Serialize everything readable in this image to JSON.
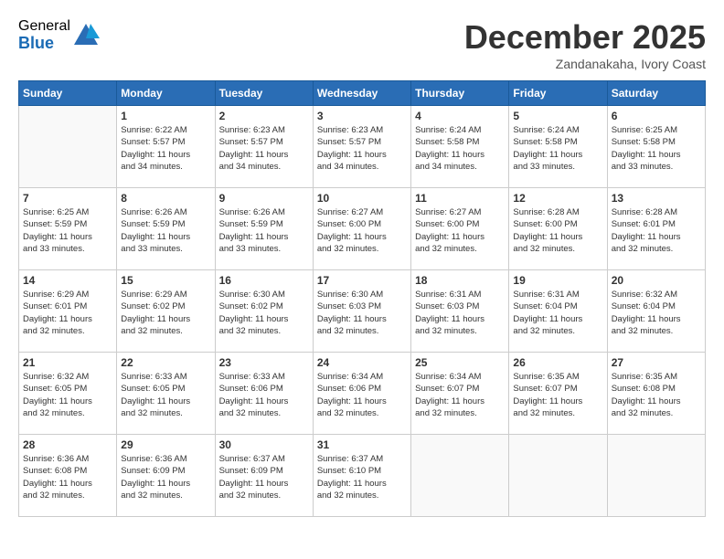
{
  "logo": {
    "general": "General",
    "blue": "Blue"
  },
  "title": "December 2025",
  "location": "Zandanakaha, Ivory Coast",
  "days_of_week": [
    "Sunday",
    "Monday",
    "Tuesday",
    "Wednesday",
    "Thursday",
    "Friday",
    "Saturday"
  ],
  "weeks": [
    [
      {
        "day": "",
        "sunrise": "",
        "sunset": "",
        "daylight": ""
      },
      {
        "day": "1",
        "sunrise": "Sunrise: 6:22 AM",
        "sunset": "Sunset: 5:57 PM",
        "daylight": "Daylight: 11 hours and 34 minutes."
      },
      {
        "day": "2",
        "sunrise": "Sunrise: 6:23 AM",
        "sunset": "Sunset: 5:57 PM",
        "daylight": "Daylight: 11 hours and 34 minutes."
      },
      {
        "day": "3",
        "sunrise": "Sunrise: 6:23 AM",
        "sunset": "Sunset: 5:57 PM",
        "daylight": "Daylight: 11 hours and 34 minutes."
      },
      {
        "day": "4",
        "sunrise": "Sunrise: 6:24 AM",
        "sunset": "Sunset: 5:58 PM",
        "daylight": "Daylight: 11 hours and 34 minutes."
      },
      {
        "day": "5",
        "sunrise": "Sunrise: 6:24 AM",
        "sunset": "Sunset: 5:58 PM",
        "daylight": "Daylight: 11 hours and 33 minutes."
      },
      {
        "day": "6",
        "sunrise": "Sunrise: 6:25 AM",
        "sunset": "Sunset: 5:58 PM",
        "daylight": "Daylight: 11 hours and 33 minutes."
      }
    ],
    [
      {
        "day": "7",
        "sunrise": "Sunrise: 6:25 AM",
        "sunset": "Sunset: 5:59 PM",
        "daylight": "Daylight: 11 hours and 33 minutes."
      },
      {
        "day": "8",
        "sunrise": "Sunrise: 6:26 AM",
        "sunset": "Sunset: 5:59 PM",
        "daylight": "Daylight: 11 hours and 33 minutes."
      },
      {
        "day": "9",
        "sunrise": "Sunrise: 6:26 AM",
        "sunset": "Sunset: 5:59 PM",
        "daylight": "Daylight: 11 hours and 33 minutes."
      },
      {
        "day": "10",
        "sunrise": "Sunrise: 6:27 AM",
        "sunset": "Sunset: 6:00 PM",
        "daylight": "Daylight: 11 hours and 32 minutes."
      },
      {
        "day": "11",
        "sunrise": "Sunrise: 6:27 AM",
        "sunset": "Sunset: 6:00 PM",
        "daylight": "Daylight: 11 hours and 32 minutes."
      },
      {
        "day": "12",
        "sunrise": "Sunrise: 6:28 AM",
        "sunset": "Sunset: 6:00 PM",
        "daylight": "Daylight: 11 hours and 32 minutes."
      },
      {
        "day": "13",
        "sunrise": "Sunrise: 6:28 AM",
        "sunset": "Sunset: 6:01 PM",
        "daylight": "Daylight: 11 hours and 32 minutes."
      }
    ],
    [
      {
        "day": "14",
        "sunrise": "Sunrise: 6:29 AM",
        "sunset": "Sunset: 6:01 PM",
        "daylight": "Daylight: 11 hours and 32 minutes."
      },
      {
        "day": "15",
        "sunrise": "Sunrise: 6:29 AM",
        "sunset": "Sunset: 6:02 PM",
        "daylight": "Daylight: 11 hours and 32 minutes."
      },
      {
        "day": "16",
        "sunrise": "Sunrise: 6:30 AM",
        "sunset": "Sunset: 6:02 PM",
        "daylight": "Daylight: 11 hours and 32 minutes."
      },
      {
        "day": "17",
        "sunrise": "Sunrise: 6:30 AM",
        "sunset": "Sunset: 6:03 PM",
        "daylight": "Daylight: 11 hours and 32 minutes."
      },
      {
        "day": "18",
        "sunrise": "Sunrise: 6:31 AM",
        "sunset": "Sunset: 6:03 PM",
        "daylight": "Daylight: 11 hours and 32 minutes."
      },
      {
        "day": "19",
        "sunrise": "Sunrise: 6:31 AM",
        "sunset": "Sunset: 6:04 PM",
        "daylight": "Daylight: 11 hours and 32 minutes."
      },
      {
        "day": "20",
        "sunrise": "Sunrise: 6:32 AM",
        "sunset": "Sunset: 6:04 PM",
        "daylight": "Daylight: 11 hours and 32 minutes."
      }
    ],
    [
      {
        "day": "21",
        "sunrise": "Sunrise: 6:32 AM",
        "sunset": "Sunset: 6:05 PM",
        "daylight": "Daylight: 11 hours and 32 minutes."
      },
      {
        "day": "22",
        "sunrise": "Sunrise: 6:33 AM",
        "sunset": "Sunset: 6:05 PM",
        "daylight": "Daylight: 11 hours and 32 minutes."
      },
      {
        "day": "23",
        "sunrise": "Sunrise: 6:33 AM",
        "sunset": "Sunset: 6:06 PM",
        "daylight": "Daylight: 11 hours and 32 minutes."
      },
      {
        "day": "24",
        "sunrise": "Sunrise: 6:34 AM",
        "sunset": "Sunset: 6:06 PM",
        "daylight": "Daylight: 11 hours and 32 minutes."
      },
      {
        "day": "25",
        "sunrise": "Sunrise: 6:34 AM",
        "sunset": "Sunset: 6:07 PM",
        "daylight": "Daylight: 11 hours and 32 minutes."
      },
      {
        "day": "26",
        "sunrise": "Sunrise: 6:35 AM",
        "sunset": "Sunset: 6:07 PM",
        "daylight": "Daylight: 11 hours and 32 minutes."
      },
      {
        "day": "27",
        "sunrise": "Sunrise: 6:35 AM",
        "sunset": "Sunset: 6:08 PM",
        "daylight": "Daylight: 11 hours and 32 minutes."
      }
    ],
    [
      {
        "day": "28",
        "sunrise": "Sunrise: 6:36 AM",
        "sunset": "Sunset: 6:08 PM",
        "daylight": "Daylight: 11 hours and 32 minutes."
      },
      {
        "day": "29",
        "sunrise": "Sunrise: 6:36 AM",
        "sunset": "Sunset: 6:09 PM",
        "daylight": "Daylight: 11 hours and 32 minutes."
      },
      {
        "day": "30",
        "sunrise": "Sunrise: 6:37 AM",
        "sunset": "Sunset: 6:09 PM",
        "daylight": "Daylight: 11 hours and 32 minutes."
      },
      {
        "day": "31",
        "sunrise": "Sunrise: 6:37 AM",
        "sunset": "Sunset: 6:10 PM",
        "daylight": "Daylight: 11 hours and 32 minutes."
      },
      {
        "day": "",
        "sunrise": "",
        "sunset": "",
        "daylight": ""
      },
      {
        "day": "",
        "sunrise": "",
        "sunset": "",
        "daylight": ""
      },
      {
        "day": "",
        "sunrise": "",
        "sunset": "",
        "daylight": ""
      }
    ]
  ]
}
